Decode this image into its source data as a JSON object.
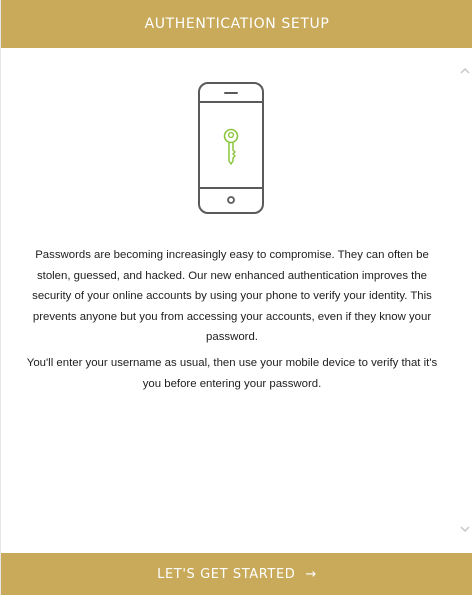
{
  "header": {
    "title": "AUTHENTICATION SETUP"
  },
  "illustration": {
    "icon": "phone-with-key-icon",
    "key_color": "#8cc63f",
    "outline_color": "#5a5a5a"
  },
  "body": {
    "paragraph_1": "Passwords are becoming increasingly easy to compromise. They can often be stolen, guessed, and hacked. Our new enhanced authentication improves the security of your online accounts by using your phone to verify your identity. This prevents anyone but you from accessing your accounts, even if they know your password.",
    "paragraph_2": "You'll enter your username as usual, then use your mobile device to verify that it's you before entering your password."
  },
  "footer": {
    "button_label": "LET'S GET STARTED",
    "arrow": "→"
  },
  "colors": {
    "accent": "#c9aa5a",
    "text": "#1e1e1e"
  }
}
